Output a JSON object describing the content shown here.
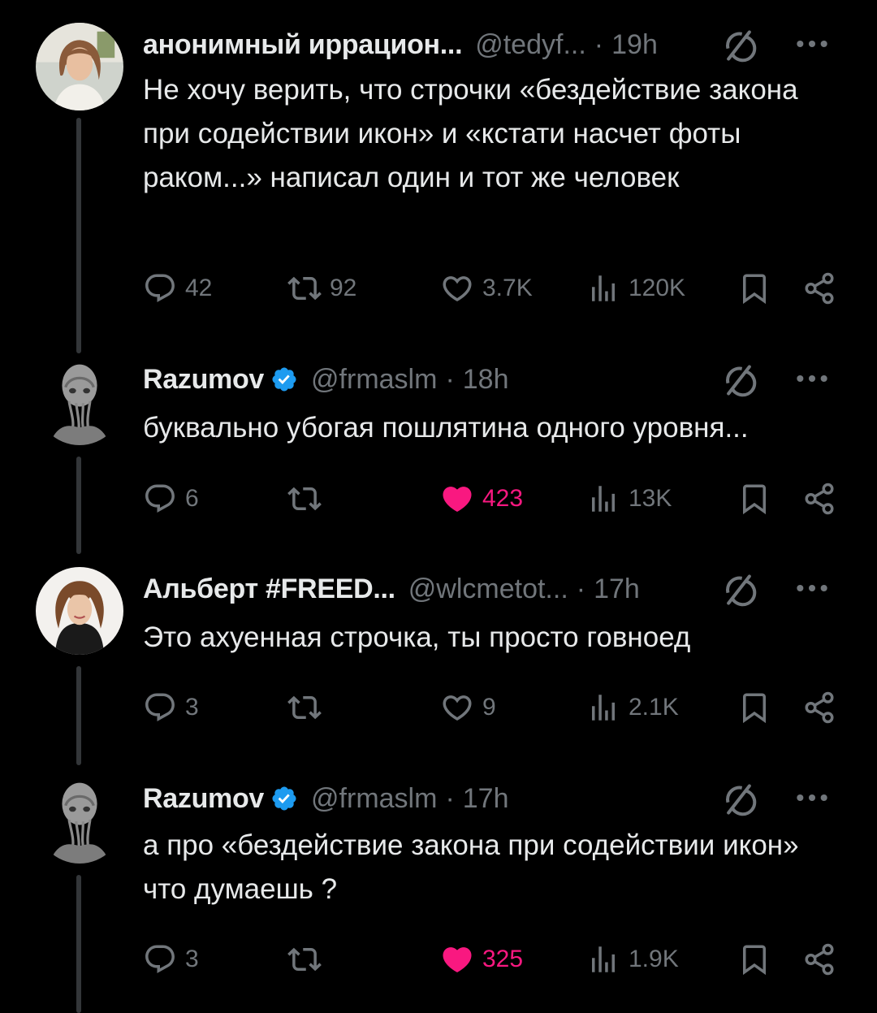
{
  "tweets": [
    {
      "name": "анонимный иррацион...",
      "verified": false,
      "handle": "@tedyf...",
      "separator": "·",
      "time": "19h",
      "text": "Не хочу верить, что строчки «бездействие закона при содействии икон» и «кстати насчет фоты раком...» написал один и тот же человек",
      "replies": "42",
      "reposts": "92",
      "likes": "3.7K",
      "liked": false,
      "views": "120K",
      "avatar_icon": "woman-portrait"
    },
    {
      "name": "Razumov",
      "verified": true,
      "handle": "@frmaslm",
      "separator": "·",
      "time": "18h",
      "text": "буквально убогая пошлятина одного уровня...",
      "replies": "6",
      "reposts": "",
      "likes": "423",
      "liked": true,
      "views": "13K",
      "avatar_icon": "alien-bust"
    },
    {
      "name": "Альберт #FREED...",
      "verified": false,
      "handle": "@wlcmetot...",
      "separator": "·",
      "time": "17h",
      "text": "Это ахуенная строчка, ты просто говноед",
      "replies": "3",
      "reposts": "",
      "likes": "9",
      "liked": false,
      "views": "2.1K",
      "avatar_icon": "woman-portrait"
    },
    {
      "name": "Razumov",
      "verified": true,
      "handle": "@frmaslm",
      "separator": "·",
      "time": "17h",
      "text": "а про «бездействие закона при содействии икон» что думаешь ?",
      "replies": "3",
      "reposts": "",
      "likes": "325",
      "liked": true,
      "views": "1.9K",
      "avatar_icon": "alien-bust"
    }
  ],
  "colors": {
    "background": "#000000",
    "text": "#e7e9ea",
    "muted": "#71767b",
    "like_active": "#f91880",
    "verified": "#1d9bf0",
    "thread_line": "#333639"
  }
}
